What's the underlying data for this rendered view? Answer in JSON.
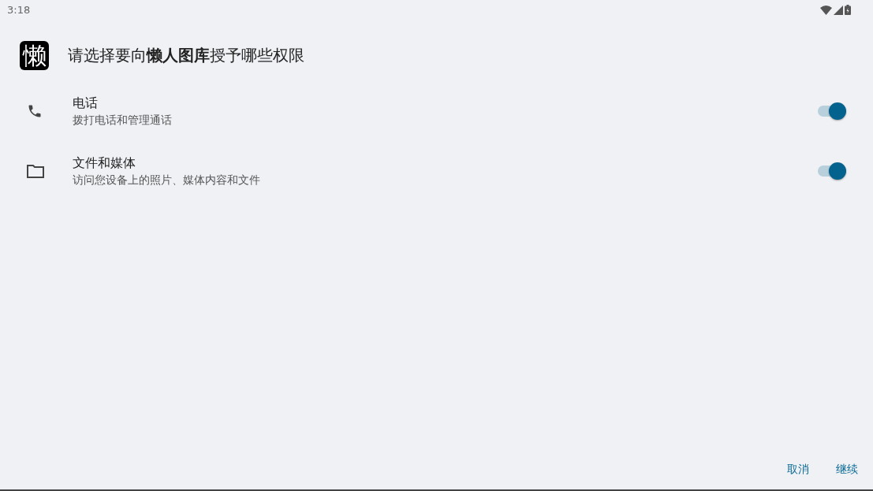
{
  "status_bar": {
    "time": "3:18"
  },
  "header": {
    "app_icon_text": "懒",
    "title": "请选择要向**懒人图库**授予哪些权限"
  },
  "permissions": [
    {
      "kind": "phone",
      "name": "电话",
      "description": "拨打电话和管理通话",
      "on": true
    },
    {
      "kind": "folder",
      "name": "文件和媒体",
      "description": "访问您设备上的照片、媒体内容和文件",
      "on": true
    }
  ],
  "buttons": [
    "取消",
    "继续"
  ]
}
